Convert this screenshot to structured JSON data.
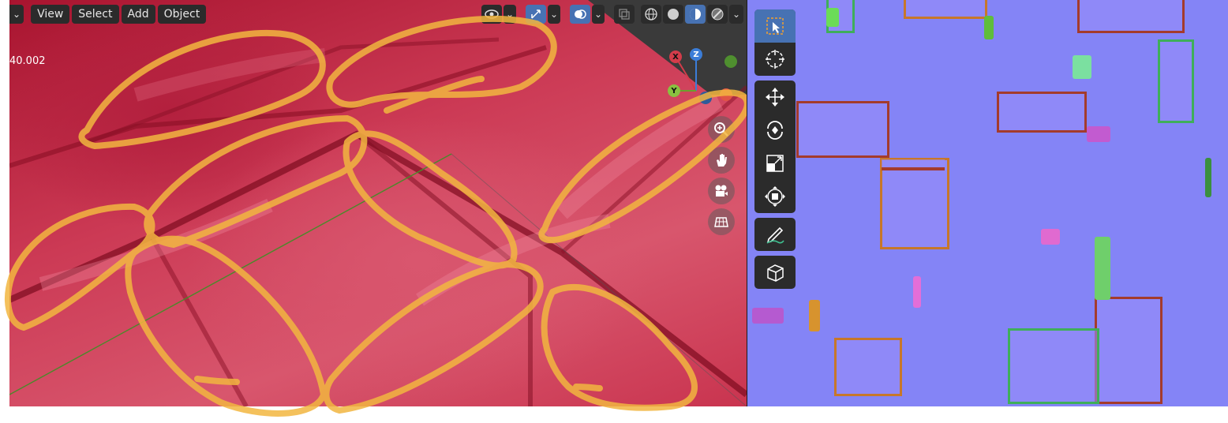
{
  "header": {
    "menus": [
      "View",
      "Select",
      "Add",
      "Object"
    ],
    "chevron": "⌄"
  },
  "viewport": {
    "stat_value": "40.002",
    "gizmo": {
      "axis_x": "X",
      "axis_y": "Y",
      "axis_z": "Z"
    },
    "nav_icons": [
      "zoom-icon",
      "pan-hand-icon",
      "camera-icon",
      "grid-icon"
    ],
    "header_icons": [
      "visibility-icon",
      "gizmo-icon",
      "overlay-icon",
      "xray-icon",
      "wireframe-shading-icon",
      "solid-shading-icon",
      "material-shading-icon",
      "rendered-shading-icon"
    ]
  },
  "toolbar": {
    "tools": [
      "select-box",
      "cursor",
      "move",
      "rotate",
      "scale",
      "transform",
      "annotate",
      "add-cube"
    ]
  },
  "colors": {
    "ui_dark": "#2b2b2b",
    "accent": "#4772b3",
    "annotation": "#f2b640",
    "mesh_red": "#c9344f",
    "normal_map": "#8484f6"
  }
}
